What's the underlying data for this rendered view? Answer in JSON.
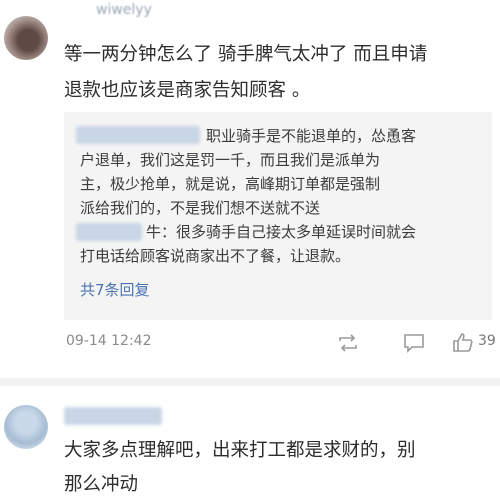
{
  "comments": [
    {
      "username": "wiwelyy",
      "text_lines": [
        "等一两分钟怎么了 骑手脾气太冲了 而且申请",
        "退款也应该是商家告知顾客 。"
      ],
      "replies": {
        "lines": [
          "职业骑手是不能退单的，怂恿客",
          "户退单，我们这是罚一千，而且我们是派单为",
          "主，极少抢单，就是说，高峰期订单都是强制",
          "派给我们的，不是我们想不送就不送",
          "牛：很多骑手自己接太多单延误时间就会",
          "打电话给顾客说商家出不了餐，让退款。"
        ],
        "more_label": "共7条回复"
      },
      "timestamp": "09-14 12:42",
      "likes": "39"
    },
    {
      "text_lines": [
        "大家多点理解吧，出来打工都是求财的，别",
        "那么冲动"
      ]
    }
  ],
  "icons": {
    "repost": "repost-icon",
    "comment": "comment-icon",
    "like": "thumbs-up-icon"
  },
  "colors": {
    "link": "#4a73b4",
    "reply_background": "#f4f4f4",
    "meta_text": "#8a8a8a"
  }
}
